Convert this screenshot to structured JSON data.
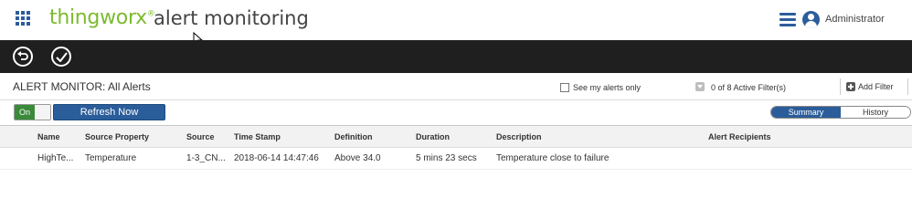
{
  "header": {
    "brand": "thingworx",
    "brand_mark": "®",
    "title": "alert monitoring",
    "user": "Administrator"
  },
  "toolbar": {
    "icons": [
      "undo-icon",
      "checkmark-icon"
    ]
  },
  "page": {
    "title": "ALERT MONITOR: All Alerts",
    "my_alerts_label": "See my alerts only",
    "filter_count": "0 of 8 Active Filter(s)",
    "add_filter_label": "Add Filter"
  },
  "controls": {
    "toggle_label": "On",
    "refresh_label": "Refresh Now",
    "tabs": [
      "Summary",
      "History"
    ],
    "active_tab": "Summary"
  },
  "grid": {
    "columns": [
      "Name",
      "Source Property",
      "Source",
      "Time Stamp",
      "Definition",
      "Duration",
      "Description",
      "Alert Recipients"
    ],
    "rows": [
      [
        "HighTe...",
        "Temperature",
        "1-3_CN...",
        "2018-06-14 14:47:46",
        "Above 34.0",
        "5 mins 23 secs",
        "Temperature close to failure",
        ""
      ]
    ]
  },
  "colors": {
    "brand_green": "#7cbb2f",
    "accent_blue": "#2a5d9a",
    "toolbar_bg": "#1f1f1f",
    "toggle_on": "#3a8a3a"
  }
}
